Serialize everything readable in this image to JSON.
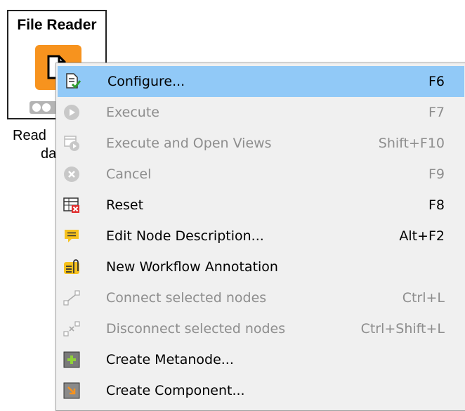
{
  "node": {
    "title": "File Reader",
    "caption_line1": "Read",
    "caption_line2": "da"
  },
  "menu": {
    "items": [
      {
        "label": "Configure...",
        "shortcut": "F6",
        "icon": "configure-icon",
        "enabled": true,
        "selected": true
      },
      {
        "label": "Execute",
        "shortcut": "F7",
        "icon": "execute-icon",
        "enabled": false
      },
      {
        "label": "Execute and Open Views",
        "shortcut": "Shift+F10",
        "icon": "execute-open-views-icon",
        "enabled": false
      },
      {
        "label": "Cancel",
        "shortcut": "F9",
        "icon": "cancel-icon",
        "enabled": false
      },
      {
        "label": "Reset",
        "shortcut": "F8",
        "icon": "reset-icon",
        "enabled": true
      },
      {
        "label": "Edit Node Description...",
        "shortcut": "Alt+F2",
        "icon": "edit-description-icon",
        "enabled": true
      },
      {
        "label": "New Workflow Annotation",
        "shortcut": "",
        "icon": "annotation-icon",
        "enabled": true
      },
      {
        "label": "Connect selected nodes",
        "shortcut": "Ctrl+L",
        "icon": "connect-icon",
        "enabled": false
      },
      {
        "label": "Disconnect selected nodes",
        "shortcut": "Ctrl+Shift+L",
        "icon": "disconnect-icon",
        "enabled": false
      },
      {
        "label": "Create Metanode...",
        "shortcut": "",
        "icon": "metanode-icon",
        "enabled": true
      },
      {
        "label": "Create Component...",
        "shortcut": "",
        "icon": "component-icon",
        "enabled": true
      }
    ]
  },
  "colors": {
    "node_orange": "#f7931e",
    "selection": "#91c9f7",
    "menu_bg": "#f0f0f0",
    "disabled_text": "#8d8d8d"
  }
}
